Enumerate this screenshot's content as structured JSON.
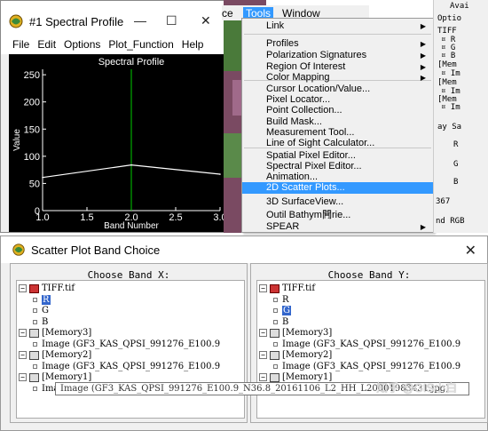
{
  "spectral_window": {
    "title": "#1 Spectral Profile",
    "menu": [
      "File",
      "Edit",
      "Options",
      "Plot_Function",
      "Help"
    ],
    "chart_data": {
      "type": "line",
      "title": "Spectral Profile",
      "xlabel": "Band Number",
      "ylabel": "Value",
      "x": [
        1.0,
        2.0,
        3.0
      ],
      "y": [
        61,
        84,
        67
      ],
      "xlim": [
        1.0,
        3.0
      ],
      "ylim": [
        0,
        260
      ],
      "xticks": [
        "1.0",
        "1.5",
        "2.0",
        "2.5",
        "3.0"
      ],
      "yticks": [
        "0",
        "50",
        "100",
        "150",
        "200",
        "250"
      ],
      "cursor_x": 2.0,
      "colors": {
        "line": "#ffffff",
        "cursor": "#00cc00",
        "background": "#000000",
        "axis": "#ffffff"
      }
    }
  },
  "tools_bar": {
    "items": [
      "ce",
      "Tools",
      "Window"
    ]
  },
  "tools_menu": {
    "items": [
      {
        "label": "Link",
        "submenu": true
      },
      {
        "label": "Profiles",
        "submenu": true
      },
      {
        "label": "Polarization Signatures",
        "submenu": true
      },
      {
        "label": "Region Of Interest",
        "submenu": true
      },
      {
        "label": "Color Mapping",
        "submenu": true
      },
      {
        "label": "Cursor Location/Value..."
      },
      {
        "label": "Pixel Locator..."
      },
      {
        "label": "Point Collection..."
      },
      {
        "label": "Build Mask..."
      },
      {
        "label": "Measurement Tool..."
      },
      {
        "label": "Line of Sight Calculator..."
      },
      {
        "label": "Spatial Pixel Editor..."
      },
      {
        "label": "Spectral Pixel Editor..."
      },
      {
        "label": "Animation..."
      },
      {
        "label": "2D Scatter Plots...",
        "selected": true
      },
      {
        "label": "3D SurfaceView..."
      },
      {
        "label": "Outil Bathym闁rie..."
      },
      {
        "label": "SPEAR",
        "submenu": true
      }
    ]
  },
  "right_panel": {
    "lines": [
      "Avai",
      "Optio",
      "TIFF",
      "¤ R",
      "¤ G",
      "¤ B",
      "[Mem",
      "¤ Im",
      "[Mem",
      "¤ Im",
      "[Mem",
      "¤ Im",
      "ay Sa",
      "R",
      "G",
      "B",
      "367",
      "nd RGB"
    ]
  },
  "scatter_dialog": {
    "title": "Scatter Plot Band Choice",
    "close_label": "✕",
    "pane_x": {
      "header": "Choose Band X:",
      "file": "TIFF.tif",
      "bands": [
        "R",
        "G",
        "B"
      ],
      "selected_band": "R",
      "memories": [
        {
          "label": "[Memory3]",
          "image": "Image (GF3_KAS_QPSI_991276_E100.9"
        },
        {
          "label": "[Memory2]",
          "image": "Image (GF3_KAS_QPSI_991276_E100.9"
        },
        {
          "label": "[Memory1]",
          "image": "Image (GF3_KAS_QPSI_991276_E100.9"
        }
      ]
    },
    "pane_y": {
      "header": "Choose Band Y:",
      "file": "TIFF.tif",
      "bands": [
        "R",
        "G",
        "B"
      ],
      "selected_band": "G",
      "memories": [
        {
          "label": "[Memory3]",
          "image": "Image (GF3_KAS_QPSI_991276_E100.9"
        },
        {
          "label": "[Memory2]",
          "image": "Image (GF3_KAS_QPSI_991276_E100.9"
        },
        {
          "label": "[Memory1]",
          "image": "Image (GF3_KAS_QPSI_991276_E100.9"
        }
      ]
    },
    "tooltip": "Image (GF3_KAS_QPSI_991276_E100.9_N36.8_20161106_L2_HH_L20001983431.jpg)"
  },
  "watermark": "知乎 @GIS小白"
}
